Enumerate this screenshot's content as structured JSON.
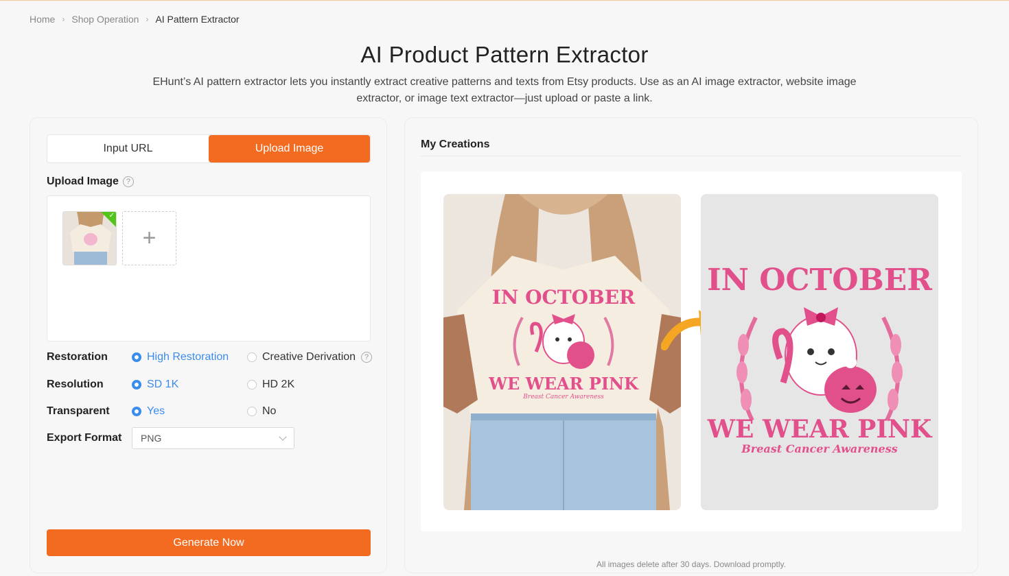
{
  "breadcrumb": {
    "home": "Home",
    "section": "Shop Operation",
    "current": "AI Pattern Extractor"
  },
  "page": {
    "title": "AI Product Pattern Extractor",
    "description": "EHunt’s AI pattern extractor lets you instantly extract creative patterns and texts from Etsy products. Use as an AI image extractor, website image extractor, or image text extractor—just upload or paste a link."
  },
  "tabs": [
    {
      "label": "Input URL",
      "active": false
    },
    {
      "label": "Upload Image",
      "active": true
    }
  ],
  "upload": {
    "label": "Upload Image",
    "help": "?",
    "add_symbol": "+"
  },
  "options": {
    "restoration": {
      "label": "Restoration",
      "a": "High Restoration",
      "b": "Creative Derivation",
      "selected": "a"
    },
    "resolution": {
      "label": "Resolution",
      "a": "SD 1K",
      "b": "HD 2K",
      "selected": "a"
    },
    "transparent": {
      "label": "Transparent",
      "a": "Yes",
      "b": "No",
      "selected": "a"
    },
    "export": {
      "label": "Export Format",
      "value": "PNG"
    }
  },
  "generate_label": "Generate Now",
  "creations": {
    "title": "My Creations",
    "artwork": {
      "line1": "IN OCTOBER",
      "line2": "WE WEAR PINK",
      "line3": "Breast Cancer Awareness"
    },
    "footnote": "All images delete after 30 days. Download promptly."
  },
  "colors": {
    "accent": "#f26b21",
    "radio": "#3b8ced",
    "pink": "#e2508c"
  }
}
